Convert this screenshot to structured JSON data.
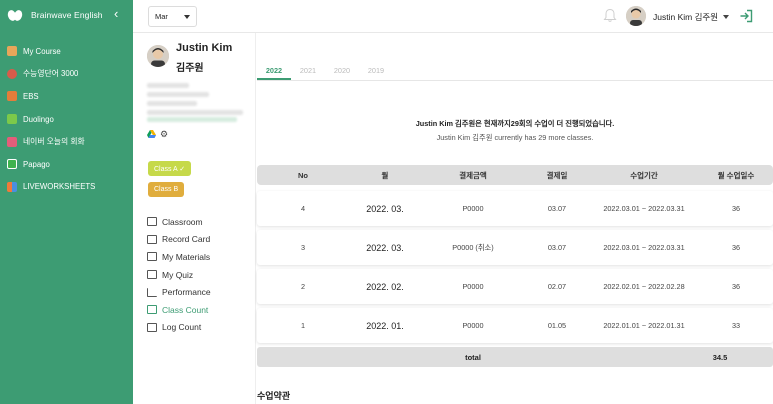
{
  "sidebar": {
    "brand": "Brainwave English",
    "items": [
      {
        "label": "My Course",
        "icon": "house-icon",
        "color": "#e8a65a"
      },
      {
        "label": "수능영단어 3000",
        "icon": "book-icon",
        "color": "#d95b4a"
      },
      {
        "label": "EBS",
        "icon": "ebs-icon",
        "color": "#e47d3a"
      },
      {
        "label": "Duolingo",
        "icon": "owl-icon",
        "color": "#7cc94a"
      },
      {
        "label": "네이버 오늘의 회화",
        "icon": "chat-icon",
        "color": "#e35d7a"
      },
      {
        "label": "Papago",
        "icon": "translate-icon",
        "color": "#3fb34f"
      },
      {
        "label": "LIVEWORKSHEETS",
        "icon": "worksheet-icon",
        "color": "#f07a3a"
      }
    ]
  },
  "topbar": {
    "month": "Mar",
    "user_name": "Justin Kim 김주원"
  },
  "profile": {
    "name_en": "Justin Kim",
    "name_ko": "김주원",
    "class_a": "Class A ✓",
    "class_b": "Class B",
    "menu": [
      {
        "label": "Classroom",
        "icon": "classroom-icon",
        "active": false
      },
      {
        "label": "Record Card",
        "icon": "card-icon",
        "active": false
      },
      {
        "label": "My Materials",
        "icon": "materials-icon",
        "active": false
      },
      {
        "label": "My Quiz",
        "icon": "quiz-icon",
        "active": false
      },
      {
        "label": "Performance",
        "icon": "performance-icon",
        "active": false
      },
      {
        "label": "Class Count",
        "icon": "class-count-icon",
        "active": true
      },
      {
        "label": "Log Count",
        "icon": "log-count-icon",
        "active": false
      }
    ]
  },
  "main": {
    "years": [
      "2022",
      "2021",
      "2020",
      "2019"
    ],
    "active_year": "2022",
    "notice_ko": "Justin Kim 김주원은 현재까지29회의 수업이 더 진행되었습니다.",
    "notice_en": "Justin Kim 김주원 currently has 29 more classes.",
    "columns": [
      "No",
      "월",
      "결제금액",
      "결제일",
      "수업기간",
      "월 수업일수"
    ],
    "rows": [
      {
        "no": "4",
        "month": "2022. 03.",
        "amount": "P0000",
        "paid": "03.07",
        "period": "2022.03.01 ~ 2022.03.31",
        "days": "36"
      },
      {
        "no": "3",
        "month": "2022. 03.",
        "amount": "P0000 (취소)",
        "paid": "03.07",
        "period": "2022.03.01 ~ 2022.03.31",
        "days": "36"
      },
      {
        "no": "2",
        "month": "2022. 02.",
        "amount": "P0000",
        "paid": "02.07",
        "period": "2022.02.01 ~ 2022.02.28",
        "days": "36"
      },
      {
        "no": "1",
        "month": "2022. 01.",
        "amount": "P0000",
        "paid": "01.05",
        "period": "2022.01.01 ~ 2022.01.31",
        "days": "33"
      }
    ],
    "total_label": "total",
    "total_value": "34.5",
    "terms_heading": "수업약관"
  },
  "colors": {
    "brand_green": "#3d9c73",
    "class_a": "#c6d94a",
    "class_b": "#e0ad3d"
  }
}
